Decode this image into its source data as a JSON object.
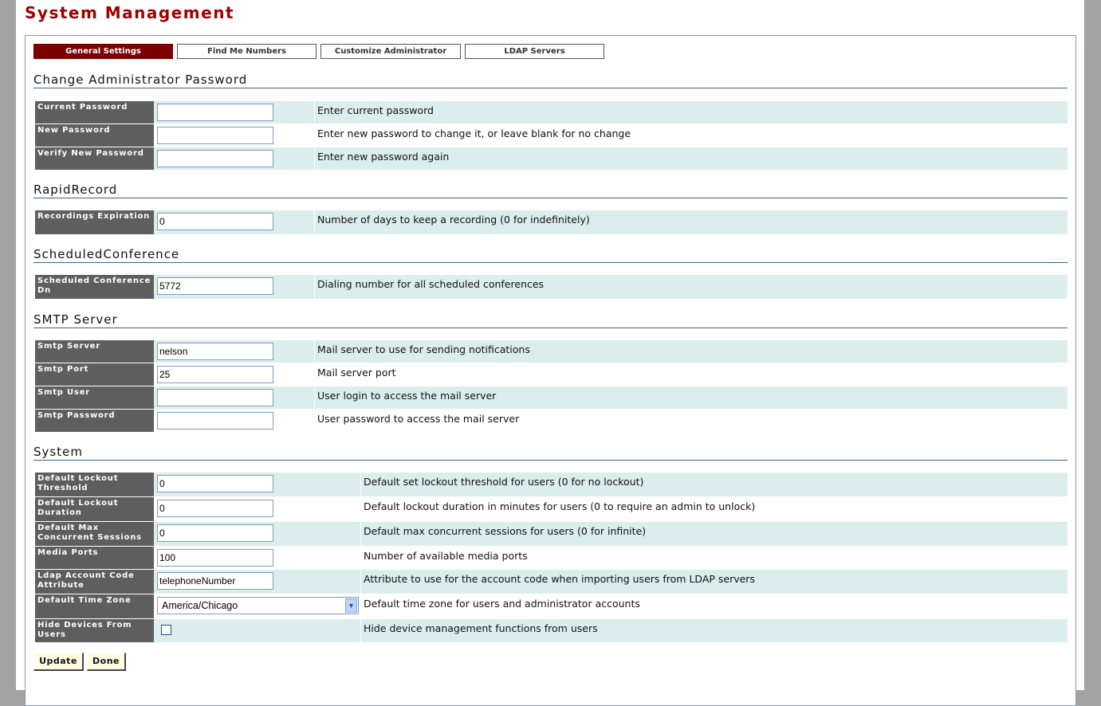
{
  "page": {
    "title": "System Management"
  },
  "tabs": [
    {
      "label": "General Settings",
      "active": true
    },
    {
      "label": "Find Me Numbers",
      "active": false
    },
    {
      "label": "Customize Administrator",
      "active": false
    },
    {
      "label": "LDAP Servers",
      "active": false
    }
  ],
  "sections": {
    "password": {
      "title": "Change Administrator Password",
      "rows": [
        {
          "label": "Current Password",
          "value": "",
          "description": "Enter current password"
        },
        {
          "label": "New Password",
          "value": "",
          "description": "Enter new password to change it, or leave blank for no change"
        },
        {
          "label": "Verify New Password",
          "value": "",
          "description": "Enter new password again"
        }
      ]
    },
    "rapid_record": {
      "title": "RapidRecord",
      "rows": [
        {
          "label": "Recordings Expiration",
          "value": "0",
          "description": "Number of days to keep a recording (0 for indefinitely)"
        }
      ]
    },
    "scheduled_conference": {
      "title": "ScheduledConference",
      "rows": [
        {
          "label": "Scheduled Conference Dn",
          "value": "5772",
          "description": "Dialing number for all scheduled conferences"
        }
      ]
    },
    "smtp": {
      "title": "SMTP Server",
      "rows": [
        {
          "label": "Smtp Server",
          "value": "nelson",
          "description": "Mail server to use for sending notifications"
        },
        {
          "label": "Smtp Port",
          "value": "25",
          "description": "Mail server port"
        },
        {
          "label": "Smtp User",
          "value": "",
          "description": "User login to access the mail server"
        },
        {
          "label": "Smtp Password",
          "value": "",
          "description": "User password to access the mail server"
        }
      ]
    },
    "system": {
      "title": "System",
      "rows": [
        {
          "label": "Default Lockout Threshold",
          "value": "0",
          "description": "Default set lockout threshold for users (0 for no lockout)"
        },
        {
          "label": "Default Lockout Duration",
          "value": "0",
          "description": "Default lockout duration in minutes for users (0 to require an admin to unlock)"
        },
        {
          "label": "Default Max Concurrent Sessions",
          "value": "0",
          "description": "Default max concurrent sessions for users (0 for infinite)"
        },
        {
          "label": "Media Ports",
          "value": "100",
          "description": "Number of available media ports"
        },
        {
          "label": "Ldap Account Code Attribute",
          "value": "telephoneNumber",
          "description": "Attribute to use for the account code when importing users from LDAP servers"
        },
        {
          "label": "Default Time Zone",
          "value": "America/Chicago",
          "description": "Default time zone for users and administrator accounts"
        },
        {
          "label": "Hide Devices From Users",
          "value": "",
          "checked": false,
          "description": "Hide device management functions from users"
        }
      ]
    }
  },
  "buttons": {
    "update": "Update",
    "done": "Done"
  },
  "colors": {
    "title": "#a00000",
    "active_tab": "#7a0000",
    "label_bg": "#5e5e5e",
    "row_shade": "#dceded",
    "rule": "#3c6482"
  }
}
